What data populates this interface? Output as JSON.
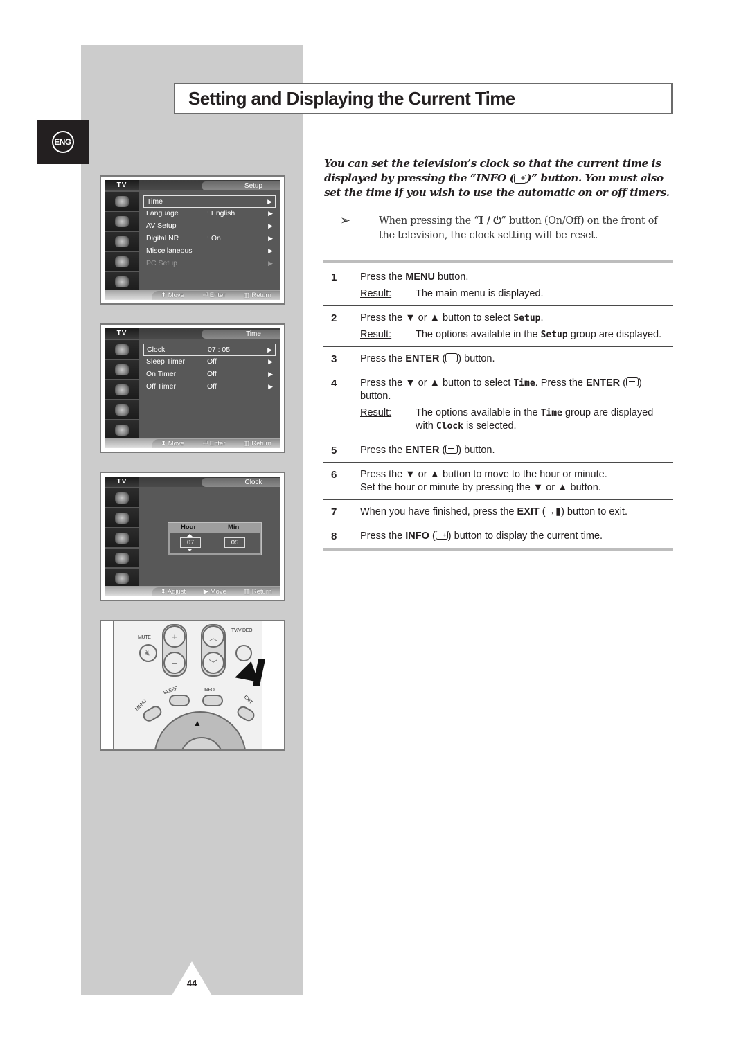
{
  "page": {
    "title": "Setting and Displaying the Current Time",
    "language_tab": "ENG",
    "page_number": "44"
  },
  "osd_screens": [
    {
      "tv_label": "TV",
      "title": "Setup",
      "rows": [
        {
          "label": "Time",
          "value": "",
          "selected": true,
          "dim": false
        },
        {
          "label": "Language",
          "value": ":  English",
          "selected": false,
          "dim": false
        },
        {
          "label": "AV Setup",
          "value": "",
          "selected": false,
          "dim": false
        },
        {
          "label": "Digital NR",
          "value": ":  On",
          "selected": false,
          "dim": false
        },
        {
          "label": "Miscellaneous",
          "value": "",
          "selected": false,
          "dim": false
        },
        {
          "label": "PC Setup",
          "value": "",
          "selected": false,
          "dim": true
        }
      ],
      "footer": [
        "Move",
        "Enter",
        "Return"
      ]
    },
    {
      "tv_label": "TV",
      "title": "Time",
      "rows": [
        {
          "label": "Clock",
          "value": "07 : 05",
          "selected": true,
          "dim": false
        },
        {
          "label": "Sleep Timer",
          "value": "Off",
          "selected": false,
          "dim": false
        },
        {
          "label": "On Timer",
          "value": "Off",
          "selected": false,
          "dim": false
        },
        {
          "label": "Off Timer",
          "value": "Off",
          "selected": false,
          "dim": false
        }
      ],
      "footer": [
        "Move",
        "Enter",
        "Return"
      ]
    },
    {
      "tv_label": "TV",
      "title": "Clock",
      "clock": {
        "hour_label": "Hour",
        "min_label": "Min",
        "hour": "07",
        "min": "05"
      },
      "footer": [
        "Adjust",
        "Move",
        "Return"
      ]
    }
  ],
  "remote": {
    "labels": {
      "mute": "MUTE",
      "tv_video": "TV/VIDEO",
      "sleep": "SLEEP",
      "info": "INFO",
      "menu": "MENU",
      "exit": "EXIT"
    }
  },
  "intro": {
    "line_before_icon": "You can set the television’s clock so that the current time is displayed by pressing the “INFO (",
    "line_after_icon": ")” button. You must also set the time if you wish to use the automatic on or off timers."
  },
  "note": {
    "before": "When pressing the “",
    "power_label": "I / ⏻",
    "after": "” button (On/Off) on the front of the television, the clock setting will be reset."
  },
  "steps": [
    {
      "num": "1",
      "parts": [
        "Press the ",
        "MENU",
        " button."
      ],
      "result": "The main menu is displayed."
    },
    {
      "num": "2",
      "parts": [
        "Press the ▼ or ▲ button to select ",
        "Setup",
        "."
      ],
      "result_parts": [
        "The options available in the ",
        "Setup",
        " group are displayed."
      ]
    },
    {
      "num": "3",
      "parts": [
        "Press the ",
        "ENTER",
        " (",
        ") button."
      ]
    },
    {
      "num": "4",
      "parts": [
        "Press the ▼ or ▲ button to select ",
        "Time",
        ". Press the ",
        "ENTER",
        " (",
        ") button."
      ],
      "result_parts": [
        "The options available in the ",
        "Time",
        " group are displayed with ",
        "Clock",
        " is selected."
      ]
    },
    {
      "num": "5",
      "parts": [
        "Press the ",
        "ENTER",
        " (",
        ") button."
      ]
    },
    {
      "num": "6",
      "line1": "Press the ▼ or ▲ button to move to the hour or minute.",
      "line2": "Set the hour or minute by pressing the ▼ or ▲ button."
    },
    {
      "num": "7",
      "parts": [
        "When you have finished, press the ",
        "EXIT",
        " (",
        ") button to exit."
      ]
    },
    {
      "num": "8",
      "parts": [
        "Press the ",
        "INFO",
        " (",
        ") button to display the current time."
      ]
    }
  ],
  "result_label": "Result:",
  "colors": {
    "gray_column": "#cccccc",
    "osd_bg": "#585858",
    "text": "#231f20"
  }
}
